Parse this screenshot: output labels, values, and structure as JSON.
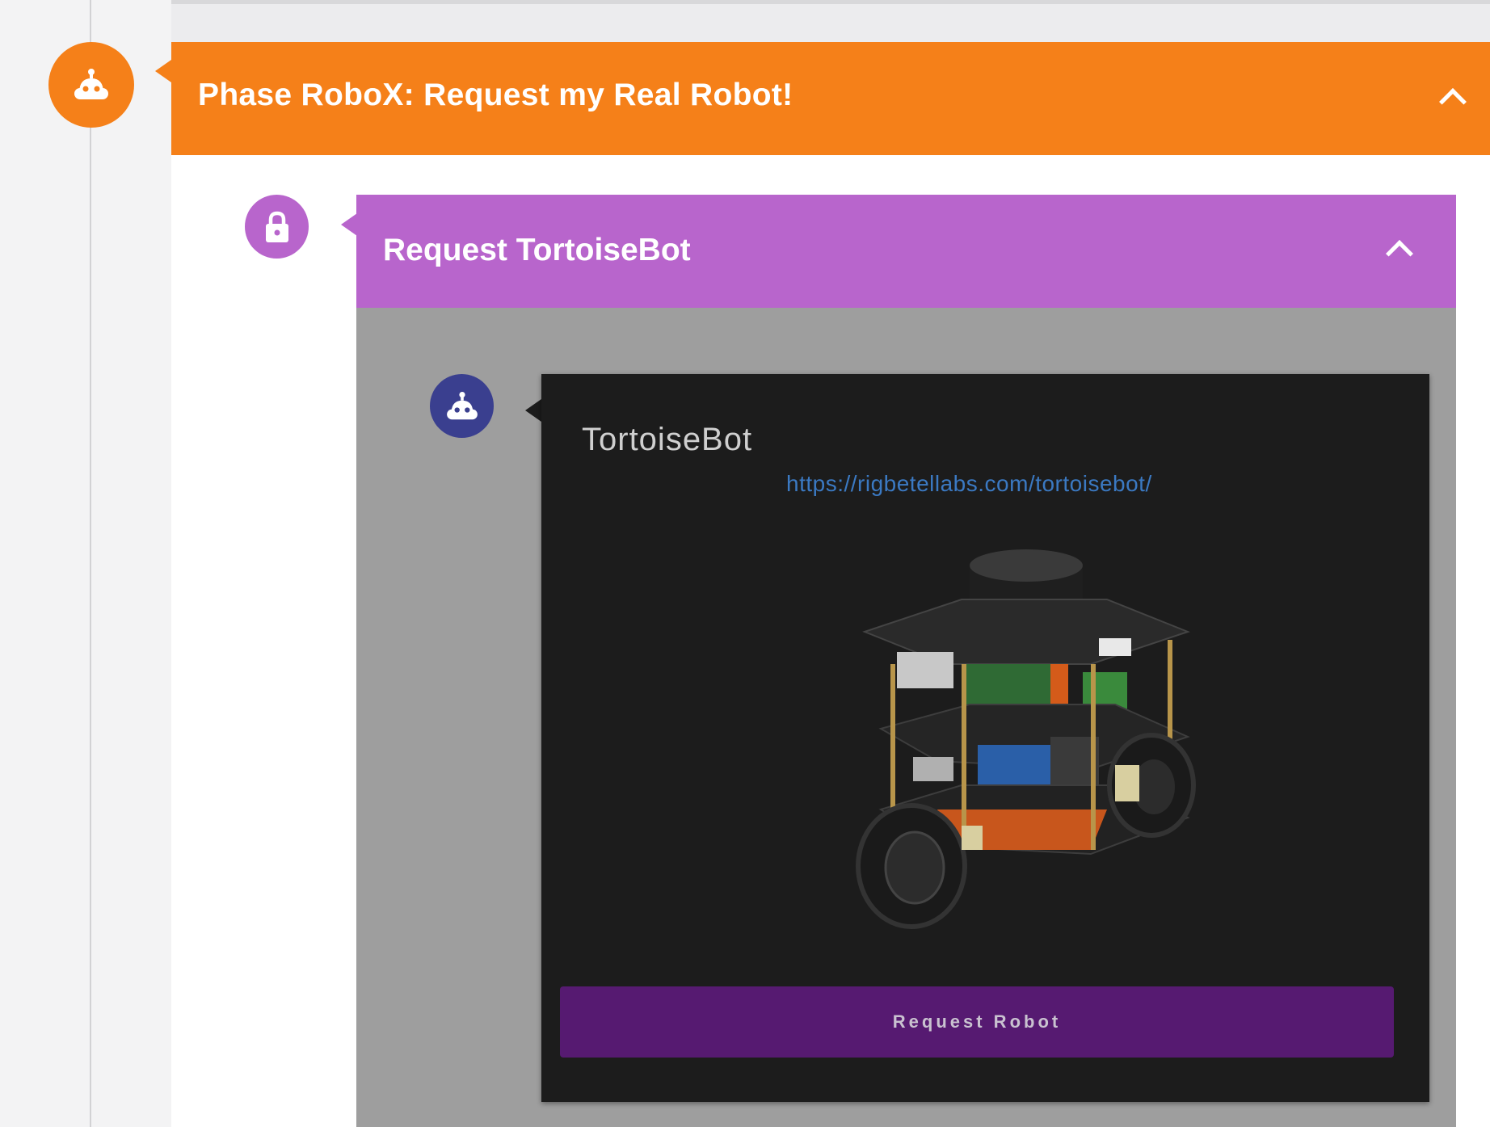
{
  "phase": {
    "title": "Phase RoboX: Request my Real Robot!",
    "icon": "robot-icon",
    "color": "#f58019"
  },
  "section": {
    "title": "Request TortoiseBot",
    "icon": "lock-icon",
    "color": "#b865cc"
  },
  "card": {
    "icon": "robot-icon",
    "title": "TortoiseBot",
    "link": "https://rigbetellabs.com/tortoisebot/",
    "image": "tortoisebot-robot-image",
    "button_label": "Request Robot",
    "button_color": "#561a71"
  }
}
